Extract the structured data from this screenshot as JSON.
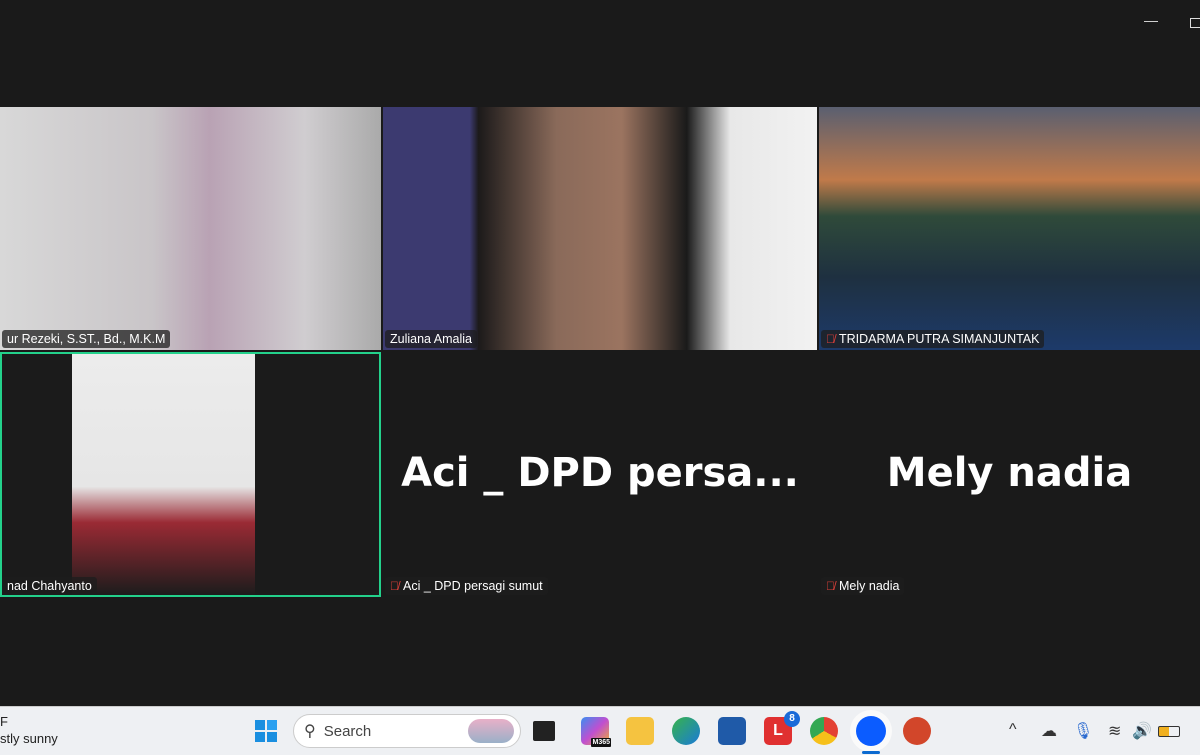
{
  "window": {
    "minimize_icon": "minimize-icon",
    "restore_icon": "restore-icon"
  },
  "participants": [
    {
      "label": "ur Rezeki, S.ST., Bd., M.K.M",
      "muted": false,
      "video": true
    },
    {
      "label": "Zuliana Amalia",
      "muted": false,
      "video": true
    },
    {
      "label": "TRIDARMA PUTRA SIMANJUNTAK",
      "muted": true,
      "video": true
    },
    {
      "label": "nad Chahyanto",
      "muted": false,
      "video": true,
      "active_speaker": true
    },
    {
      "label": "Aci _ DPD persagi sumut",
      "display_name": "Aci _ DPD persa...",
      "muted": true,
      "video": false
    },
    {
      "label": "Mely nadia",
      "display_name": "Mely nadia",
      "muted": true,
      "video": false
    }
  ],
  "accent": "#23d18b",
  "taskbar": {
    "weather_temp": "F",
    "weather_text": "stly sunny",
    "search_placeholder": "Search",
    "apps": [
      "start",
      "task-view",
      "microsoft-365",
      "file-explorer",
      "edge",
      "store",
      "app-l",
      "chrome",
      "zoom",
      "powerpoint"
    ],
    "badge_l": "8",
    "m365_label": "M365"
  }
}
